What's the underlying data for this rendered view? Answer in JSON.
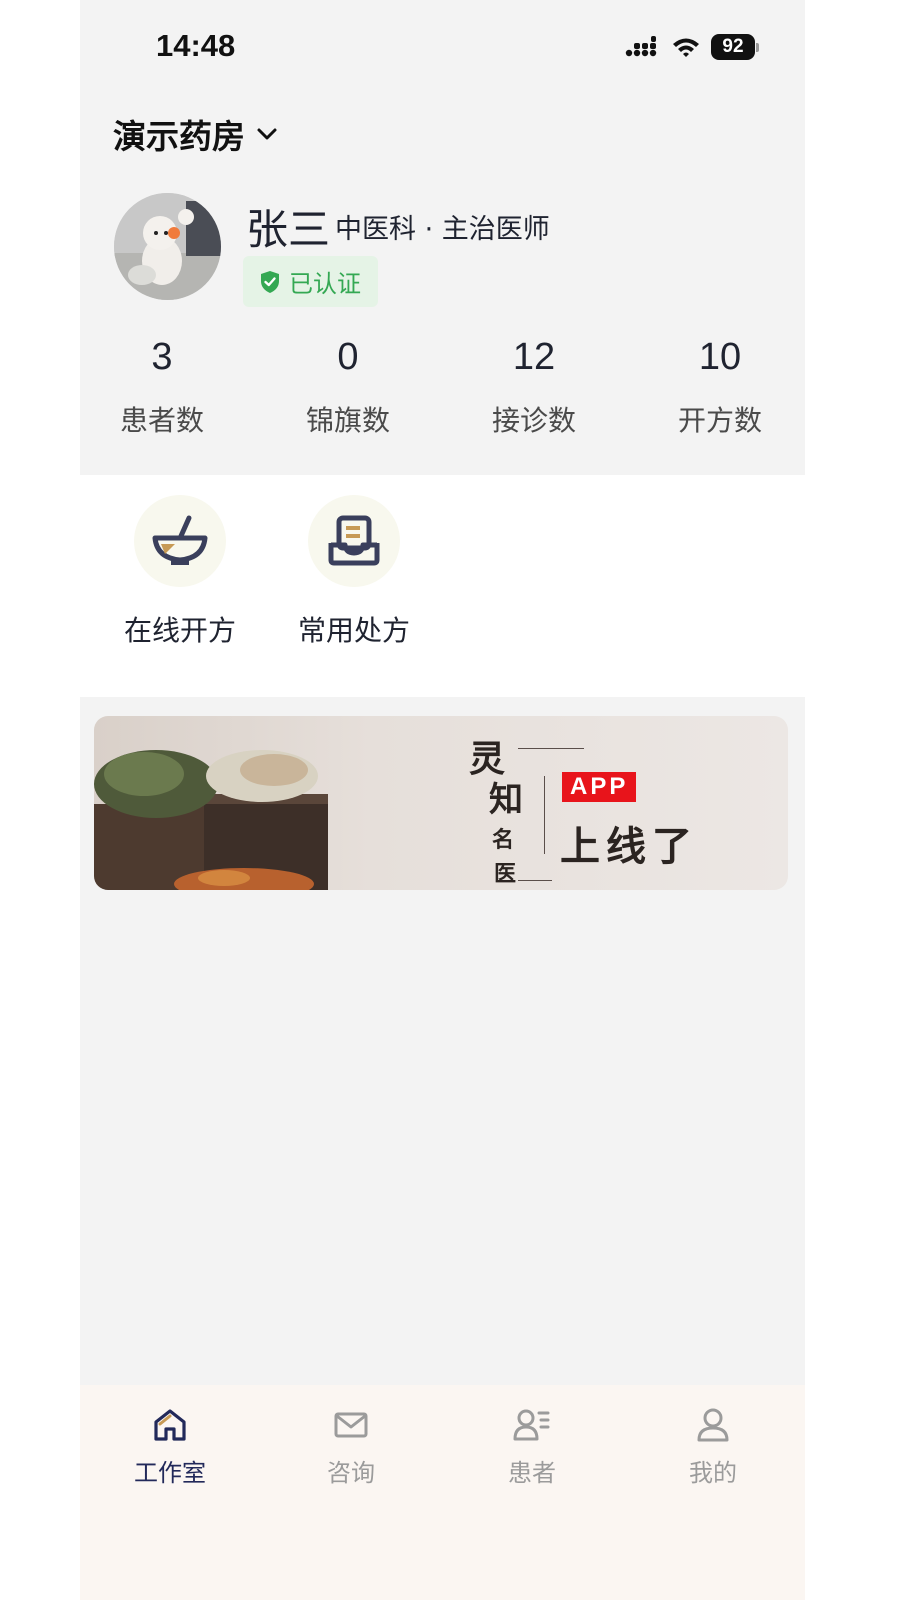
{
  "status_bar": {
    "time": "14:48",
    "battery": "92"
  },
  "header": {
    "pharmacy_name": "演示药房"
  },
  "doctor": {
    "name": "张三",
    "title": "中医科 · 主治医师",
    "verified_label": "已认证"
  },
  "stats": [
    {
      "value": "3",
      "label": "患者数"
    },
    {
      "value": "0",
      "label": "锦旗数"
    },
    {
      "value": "12",
      "label": "接诊数"
    },
    {
      "value": "10",
      "label": "开方数"
    }
  ],
  "quick_actions": [
    {
      "label": "在线开方",
      "icon": "mortar-pestle-icon"
    },
    {
      "label": "常用处方",
      "icon": "prescription-tray-icon"
    }
  ],
  "banner": {
    "vertical_1": "灵",
    "vertical_2": "知",
    "vertical_3": "名",
    "vertical_4": "医",
    "badge": "APP",
    "headline": "上线了"
  },
  "tabs": [
    {
      "label": "工作室",
      "icon": "home-icon",
      "active": true
    },
    {
      "label": "咨询",
      "icon": "mail-icon",
      "active": false
    },
    {
      "label": "患者",
      "icon": "patient-list-icon",
      "active": false
    },
    {
      "label": "我的",
      "icon": "user-icon",
      "active": false
    }
  ],
  "colors": {
    "accent": "#22295a",
    "verified_green": "#34a853",
    "badge_red": "#e8141b",
    "tab_inactive": "#9b9b9b"
  }
}
